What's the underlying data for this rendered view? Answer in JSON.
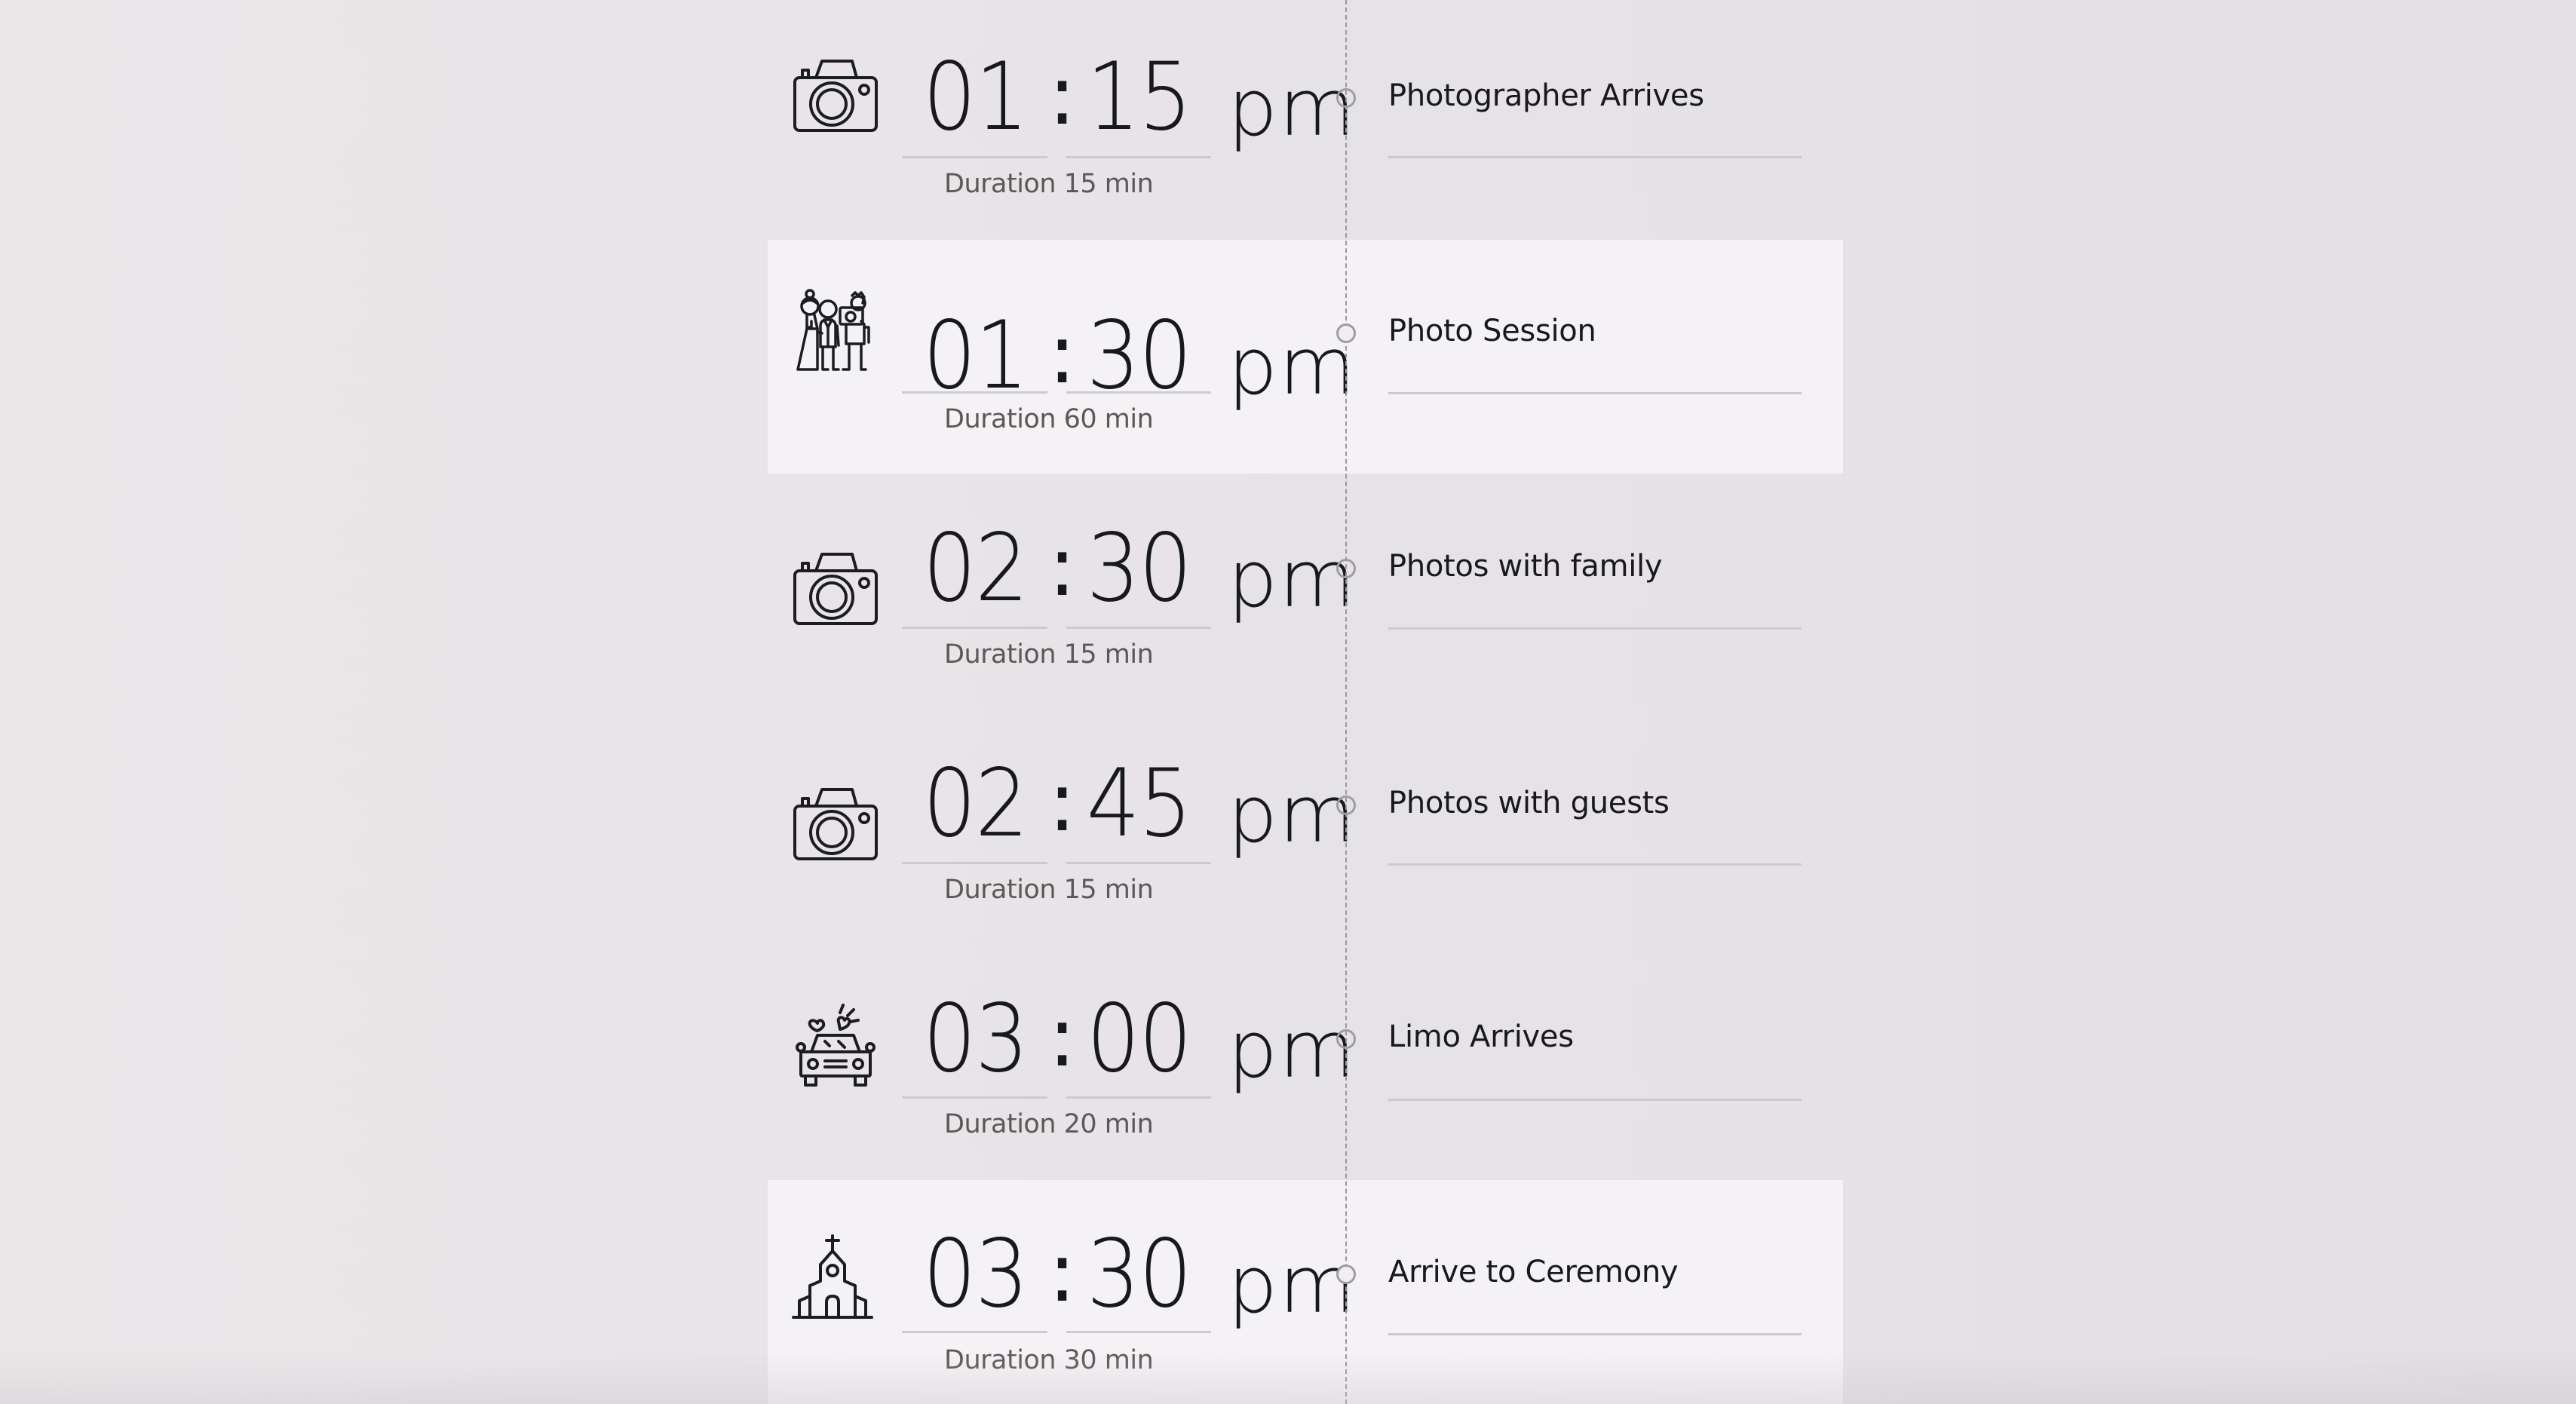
{
  "schedule": {
    "items": [
      {
        "icon": "camera-icon",
        "hours": "01",
        "separator": ":",
        "minutes": "15",
        "ampm": "pm",
        "duration_label": "Duration 15 min",
        "title": "Photographer Arrives",
        "highlighted": false
      },
      {
        "icon": "wedding-party-photo-icon",
        "hours": "01",
        "separator": ":",
        "minutes": "30",
        "ampm": "pm",
        "duration_label": "Duration 60 min",
        "title": "Photo Session",
        "highlighted": true
      },
      {
        "icon": "camera-icon",
        "hours": "02",
        "separator": ":",
        "minutes": "30",
        "ampm": "pm",
        "duration_label": "Duration 15 min",
        "title": "Photos with family",
        "highlighted": false
      },
      {
        "icon": "camera-icon",
        "hours": "02",
        "separator": ":",
        "minutes": "45",
        "ampm": "pm",
        "duration_label": "Duration 15 min",
        "title": "Photos with guests",
        "highlighted": false
      },
      {
        "icon": "wedding-car-icon",
        "hours": "03",
        "separator": ":",
        "minutes": "00",
        "ampm": "pm",
        "duration_label": "Duration 20 min",
        "title": "Limo Arrives",
        "highlighted": false
      },
      {
        "icon": "church-icon",
        "hours": "03",
        "separator": ":",
        "minutes": "30",
        "ampm": "pm",
        "duration_label": "Duration 30 min",
        "title": "Arrive to Ceremony",
        "highlighted": true
      }
    ]
  },
  "colors": {
    "background": "#e8e4e8",
    "highlight_row": "#f4f2f5",
    "text_primary": "#17191c",
    "text_secondary": "#5e5759",
    "divider": "#cdcacd",
    "timeline": "#9a979b"
  }
}
